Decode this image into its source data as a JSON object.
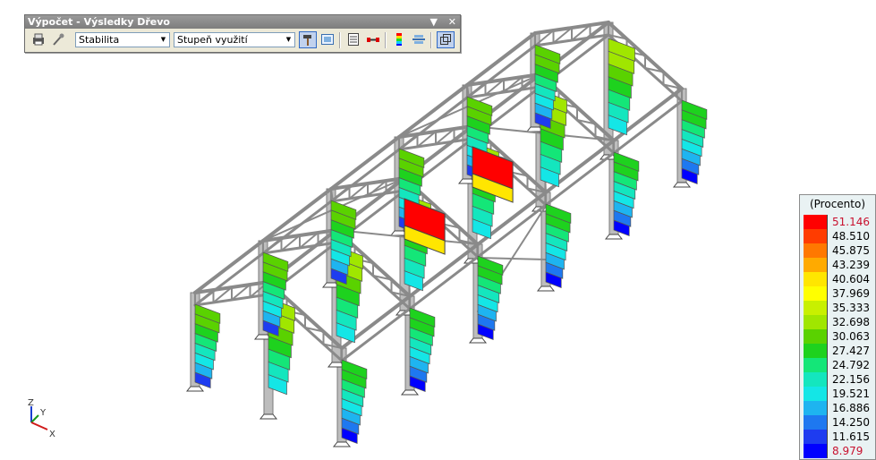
{
  "toolbar": {
    "title": "Výpočet - Výsledky Dřevo",
    "dropdown_icon": "▼",
    "close_icon": "✕",
    "combo1": "Stabilita",
    "combo2": "Stupeň využití"
  },
  "legend": {
    "header": "(Procento)",
    "max": "51.146",
    "min": "8.979",
    "values": [
      "48.510",
      "45.875",
      "43.239",
      "40.604",
      "37.969",
      "35.333",
      "32.698",
      "30.063",
      "27.427",
      "24.792",
      "22.156",
      "19.521",
      "16.886",
      "14.250",
      "11.615"
    ],
    "colors": [
      "#ff0000",
      "#ff3c00",
      "#ff7800",
      "#ffaa00",
      "#ffe600",
      "#ffff00",
      "#c8f000",
      "#a0e600",
      "#5ad200",
      "#1ed21e",
      "#14e678",
      "#14e6be",
      "#14e6e6",
      "#1eb4f0",
      "#1e78f0",
      "#1e3cf0",
      "#0000ff"
    ]
  },
  "axes": {
    "x": "X",
    "y": "Y",
    "z": "Z"
  }
}
